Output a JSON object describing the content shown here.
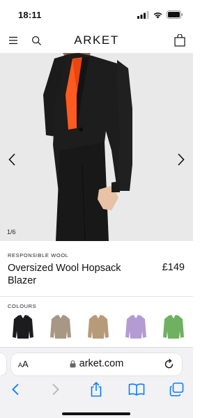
{
  "status": {
    "time": "18:11"
  },
  "header": {
    "brand": "ARKET",
    "icons": [
      "menu-icon",
      "search-icon",
      "bag-icon"
    ]
  },
  "gallery": {
    "counter": "1/6",
    "icons": [
      "chevron-left-icon",
      "chevron-right-icon"
    ]
  },
  "product": {
    "eyebrow": "RESPONSIBLE WOOL",
    "name": "Oversized Wool Hopsack Blazer",
    "price": "£149"
  },
  "colours": {
    "label": "COLOURS",
    "swatches": [
      {
        "name": "black",
        "color": "#1c1c1e"
      },
      {
        "name": "grey-beige",
        "color": "#a79784"
      },
      {
        "name": "camel",
        "color": "#b79a78"
      },
      {
        "name": "lilac",
        "color": "#b49bd4"
      },
      {
        "name": "green",
        "color": "#6fb061"
      }
    ]
  },
  "browser": {
    "text_size_label": "AA",
    "url": "arket.com",
    "icons": [
      "lock-icon",
      "reload-icon",
      "back-icon",
      "forward-icon",
      "share-icon",
      "bookmarks-icon",
      "tabs-icon"
    ]
  },
  "colors": {
    "accent": "#0a7cff",
    "hero_bg": "#eaeaea",
    "shirt": "#ff5a1f"
  }
}
